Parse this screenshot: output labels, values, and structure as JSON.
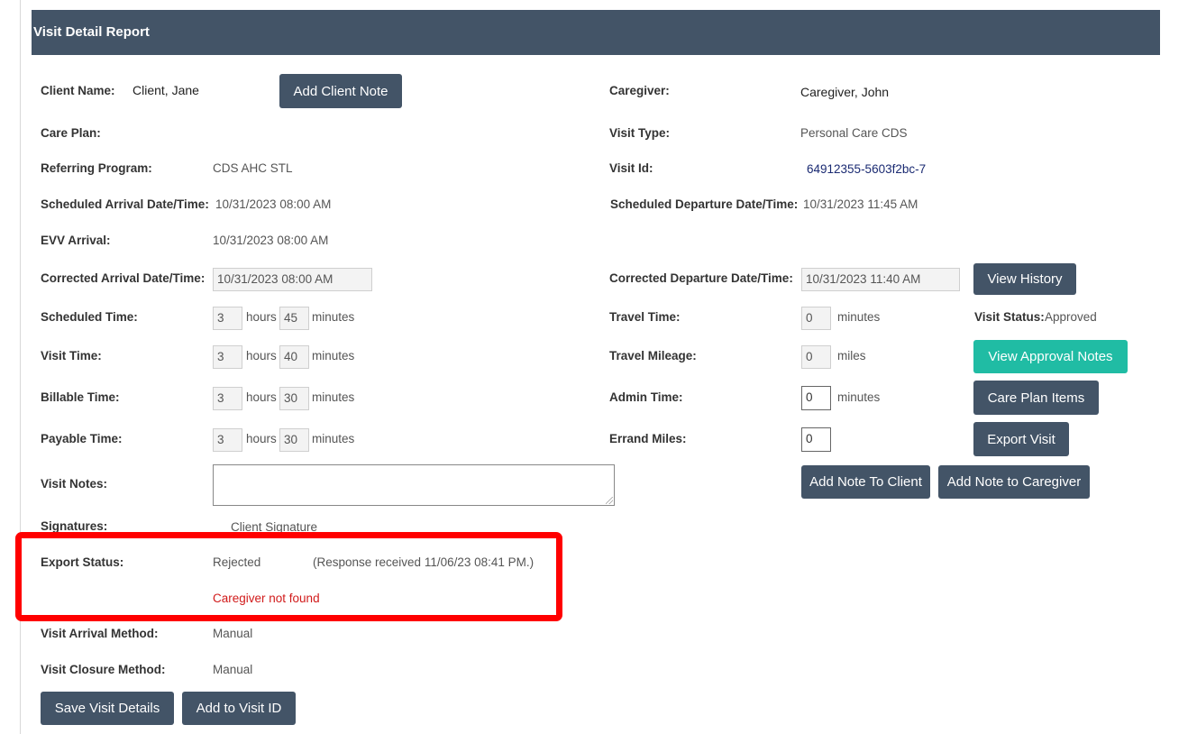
{
  "header": {
    "title": "Visit Detail Report"
  },
  "client": {
    "label": "Client Name:",
    "value": "Client, Jane",
    "add_note_button": "Add Client Note"
  },
  "caregiver": {
    "label": "Caregiver:",
    "value": "Caregiver, John"
  },
  "care_plan": {
    "label": "Care Plan:",
    "value": ""
  },
  "visit_type": {
    "label": "Visit Type:",
    "value": "Personal Care CDS"
  },
  "referring_program": {
    "label": "Referring Program:",
    "value": "CDS AHC STL"
  },
  "visit_id": {
    "label": "Visit Id:",
    "value": "64912355-5603f2bc-7"
  },
  "scheduled_arrival": {
    "label": "Scheduled Arrival Date/Time:",
    "value": "10/31/2023 08:00 AM"
  },
  "scheduled_departure": {
    "label": "Scheduled Departure Date/Time:",
    "value": "10/31/2023 11:45 AM"
  },
  "evv_arrival": {
    "label": "EVV Arrival:",
    "value": "10/31/2023 08:00 AM"
  },
  "corrected_arrival": {
    "label": "Corrected Arrival Date/Time:",
    "value": "10/31/2023 08:00 AM"
  },
  "corrected_departure": {
    "label": "Corrected Departure Date/Time:",
    "value": "10/31/2023 11:40 AM",
    "history_button": "View History"
  },
  "units": {
    "hours": "hours",
    "minutes": "minutes",
    "miles": "miles"
  },
  "scheduled_time": {
    "label": "Scheduled Time:",
    "hours": "3",
    "minutes": "45"
  },
  "travel_time": {
    "label": "Travel Time:",
    "minutes": "0"
  },
  "visit_status": {
    "label": "Visit Status:",
    "value": "Approved"
  },
  "visit_time": {
    "label": "Visit Time:",
    "hours": "3",
    "minutes": "40"
  },
  "travel_mileage": {
    "label": "Travel Mileage:",
    "miles": "0"
  },
  "approval_notes_button": "View Approval Notes",
  "billable_time": {
    "label": "Billable Time:",
    "hours": "3",
    "minutes": "30"
  },
  "admin_time": {
    "label": "Admin Time:",
    "minutes": "0"
  },
  "care_plan_items_button": "Care Plan Items",
  "payable_time": {
    "label": "Payable Time:",
    "hours": "3",
    "minutes": "30"
  },
  "errand_miles": {
    "label": "Errand Miles:",
    "value": "0"
  },
  "export_visit_button": "Export Visit",
  "visit_notes": {
    "label": "Visit Notes:",
    "value": ""
  },
  "add_note_to_client_button": "Add Note To Client",
  "add_note_to_caregiver_button": "Add Note to Caregiver",
  "signatures": {
    "label": "Signatures:",
    "value": "Client Signature"
  },
  "export_status": {
    "label": "Export Status:",
    "value": "Rejected",
    "response": "(Response received 11/06/23 08:41 PM.)",
    "error": "Caregiver not found"
  },
  "arrival_method": {
    "label": "Visit Arrival Method:",
    "value": "Manual"
  },
  "closure_method": {
    "label": "Visit Closure Method:",
    "value": "Manual"
  },
  "footer": {
    "save_button": "Save Visit Details",
    "add_visit_id_button": "Add to Visit ID"
  },
  "colors": {
    "header_bg": "#435467",
    "button_bg": "#435467",
    "teal_button": "#20bca4",
    "error_text": "#d11a1a",
    "highlight_box": "#ff0000"
  }
}
